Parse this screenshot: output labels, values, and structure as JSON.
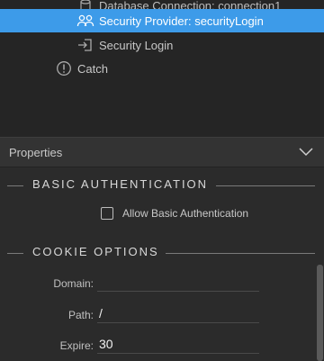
{
  "tree": {
    "partial_item": "Database Connection: connection1",
    "items": [
      {
        "label": "Security Provider: securityLogin",
        "icon": "users-icon",
        "selected": true
      },
      {
        "label": "Security Login",
        "icon": "login-icon",
        "selected": false
      },
      {
        "label": "Catch",
        "icon": "exclamation-circle-icon",
        "selected": false
      }
    ]
  },
  "properties": {
    "header_label": "Properties",
    "sections": {
      "basic_auth": {
        "title": "BASIC AUTHENTICATION",
        "checkbox_label": "Allow Basic Authentication",
        "checked": false
      },
      "cookie": {
        "title": "COOKIE OPTIONS",
        "domain_label": "Domain:",
        "domain_value": "",
        "path_label": "Path:",
        "path_value": "/",
        "expire_label": "Expire:",
        "expire_value": "30"
      }
    }
  },
  "colors": {
    "selection": "#3d9be9",
    "panel_bg": "#2b2b2b",
    "tree_bg": "#252525"
  }
}
